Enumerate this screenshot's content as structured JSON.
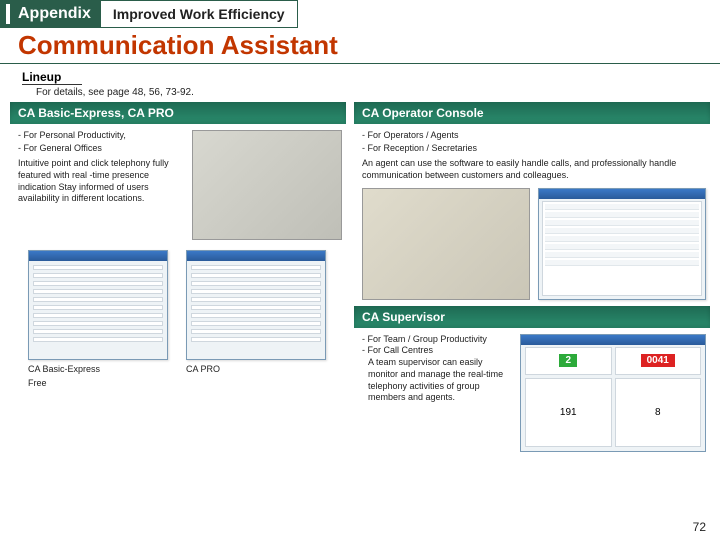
{
  "header": {
    "left": "Appendix",
    "right": "Improved Work Efficiency"
  },
  "title": "Communication Assistant",
  "lineup": {
    "label": "Lineup",
    "details": "For details, see page 48, 56, 73-92."
  },
  "left_segment": {
    "heading": "CA Basic-Express, CA PRO",
    "bullets": [
      "- For Personal Productivity,",
      "- For General Offices"
    ],
    "desc": "Intuitive point and click telephony fully featured with real -time presence indication Stay informed of users availability in different locations."
  },
  "shots": [
    {
      "caption_line1": "CA Basic-Express",
      "caption_line2": "Free"
    },
    {
      "caption_line1": "CA PRO",
      "caption_line2": ""
    }
  ],
  "right_segment_top": {
    "heading": "CA Operator Console",
    "bullets": [
      "- For Operators / Agents",
      "- For Reception / Secretaries"
    ],
    "desc": "An agent can use the software to easily handle calls, and professionally handle communication between customers and colleagues."
  },
  "right_segment_bottom": {
    "heading": "CA Supervisor",
    "bullets": [
      "- For Team / Group Productivity",
      "- For Call Centres"
    ],
    "desc": "A team supervisor can easily monitor and manage the real-time telephony activities of group members and agents.",
    "badges": {
      "a": "2",
      "b": "0041",
      "c": "191",
      "d": "8"
    }
  },
  "page_number": "72"
}
